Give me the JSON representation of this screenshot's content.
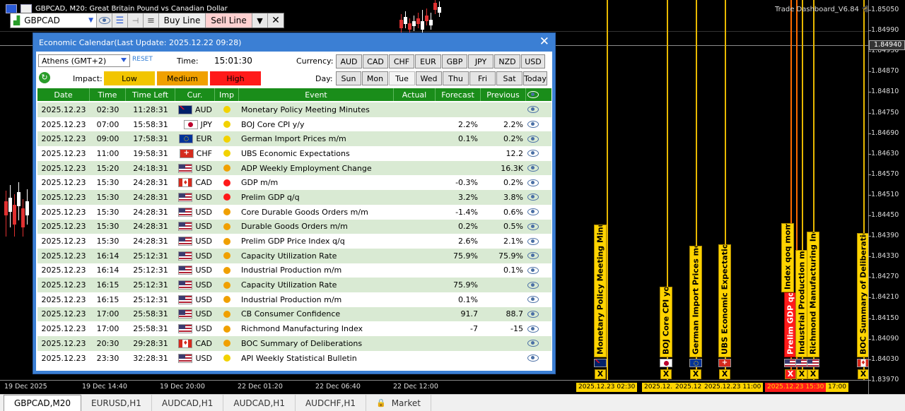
{
  "window": {
    "title": "GBPCAD, M20:  Great Britain Pound vs Canadian Dollar",
    "dashboard": "Trade Dashboard_V6.84"
  },
  "toolbar": {
    "symbol": "GBPCAD",
    "buy_label": "Buy Line",
    "sell_label": "Sell Line",
    "close_label": "✕",
    "dropdown_label": "▼"
  },
  "price_axis": {
    "ticks": [
      "1.85050",
      "1.84990",
      "1.84930",
      "1.84870",
      "1.84810",
      "1.84750",
      "1.84690",
      "1.84630",
      "1.84570",
      "1.84510",
      "1.84450",
      "1.84390",
      "1.84330",
      "1.84270",
      "1.84210",
      "1.84150",
      "1.84090",
      "1.84030",
      "1.83970"
    ],
    "current": "1.84940"
  },
  "time_axis": {
    "ticks": [
      "19 Dec 2025",
      "19 Dec 14:40",
      "19 Dec 20:00",
      "22 Dec 01:20",
      "22 Dec 06:40",
      "22 Dec 12:00"
    ],
    "badges": [
      {
        "text": "2025.12.23 02:30",
        "red": false
      },
      {
        "text": "2025.12.",
        "red": false
      },
      {
        "text": "2025.12.",
        "red": false
      },
      {
        "text": "2025.12.23 11:00",
        "red": false
      },
      {
        "text": "2025.12.23 15:30",
        "red": true
      },
      {
        "text": "17:00",
        "red": false
      }
    ]
  },
  "chart_events": [
    {
      "name": "Monetary Policy Meeting Minutes",
      "flag": "AUD",
      "red": false
    },
    {
      "name": "BOJ Core CPI yoy",
      "flag": "JPY",
      "red": false
    },
    {
      "name": "German Import Prices mom",
      "flag": "EUR",
      "red": false
    },
    {
      "name": "UBS Economic Expectations",
      "flag": "CHF",
      "red": false
    },
    {
      "name": "Prelim GDP qoq",
      "flag": "USD",
      "red": true
    },
    {
      "name": "Index qoq mom",
      "flag": "USD",
      "red": false
    },
    {
      "name": "Industrial Production mom",
      "flag": "USD",
      "red": false
    },
    {
      "name": "Richmond Manufacturing Index",
      "flag": "USD",
      "red": false
    },
    {
      "name": "BOC Summary of Deliberations",
      "flag": "CAD",
      "red": false
    }
  ],
  "x_marker": "X",
  "panel": {
    "title": "Economic Calendar(Last Update: 2025.12.22 09:28)",
    "close": "✕",
    "timezone": "Athens (GMT+2)",
    "reset": "RESET",
    "time_label": "Time:",
    "time_value": "15:01:30",
    "currency_label": "Currency:",
    "currencies": [
      "AUD",
      "CAD",
      "CHF",
      "EUR",
      "GBP",
      "JPY",
      "NZD",
      "USD"
    ],
    "impact_label": "Impact:",
    "impacts": [
      {
        "label": "Low",
        "color": "#f2c500"
      },
      {
        "label": "Medium",
        "color": "#f0a000"
      },
      {
        "label": "High",
        "color": "#ff1a1a"
      }
    ],
    "day_label": "Day:",
    "days": [
      "Sun",
      "Mon",
      "Tue",
      "Wed",
      "Thu",
      "Fri",
      "Sat",
      "Today"
    ],
    "selected_day": "Tue",
    "columns": [
      "Date",
      "Time",
      "Time Left",
      "Cur.",
      "Imp",
      "Event",
      "Actual",
      "Forecast",
      "Previous"
    ],
    "rows": [
      {
        "date": "2025.12.23",
        "time": "02:30",
        "left": "11:28:31",
        "cur": "AUD",
        "imp": "low",
        "event": "Monetary Policy Meeting Minutes",
        "actual": "",
        "forecast": "",
        "previous": ""
      },
      {
        "date": "2025.12.23",
        "time": "07:00",
        "left": "15:58:31",
        "cur": "JPY",
        "imp": "low",
        "event": "BOJ Core CPI y/y",
        "actual": "",
        "forecast": "2.2%",
        "previous": "2.2%"
      },
      {
        "date": "2025.12.23",
        "time": "09:00",
        "left": "17:58:31",
        "cur": "EUR",
        "imp": "low",
        "event": "German Import Prices m/m",
        "actual": "",
        "forecast": "0.1%",
        "previous": "0.2%"
      },
      {
        "date": "2025.12.23",
        "time": "11:00",
        "left": "19:58:31",
        "cur": "CHF",
        "imp": "low",
        "event": "UBS Economic Expectations",
        "actual": "",
        "forecast": "",
        "previous": "12.2"
      },
      {
        "date": "2025.12.23",
        "time": "15:20",
        "left": "24:18:31",
        "cur": "USD",
        "imp": "medium",
        "event": "ADP Weekly Employment Change",
        "actual": "",
        "forecast": "",
        "previous": "16.3K"
      },
      {
        "date": "2025.12.23",
        "time": "15:30",
        "left": "24:28:31",
        "cur": "CAD",
        "imp": "high",
        "event": "GDP m/m",
        "actual": "",
        "forecast": "-0.3%",
        "previous": "0.2%"
      },
      {
        "date": "2025.12.23",
        "time": "15:30",
        "left": "24:28:31",
        "cur": "USD",
        "imp": "high",
        "event": "Prelim GDP q/q",
        "actual": "",
        "forecast": "3.2%",
        "previous": "3.8%"
      },
      {
        "date": "2025.12.23",
        "time": "15:30",
        "left": "24:28:31",
        "cur": "USD",
        "imp": "medium",
        "event": "Core Durable Goods Orders m/m",
        "actual": "",
        "forecast": "-1.4%",
        "previous": "0.6%"
      },
      {
        "date": "2025.12.23",
        "time": "15:30",
        "left": "24:28:31",
        "cur": "USD",
        "imp": "medium",
        "event": "Durable Goods Orders m/m",
        "actual": "",
        "forecast": "0.2%",
        "previous": "0.5%"
      },
      {
        "date": "2025.12.23",
        "time": "15:30",
        "left": "24:28:31",
        "cur": "USD",
        "imp": "medium",
        "event": "Prelim GDP Price Index q/q",
        "actual": "",
        "forecast": "2.6%",
        "previous": "2.1%"
      },
      {
        "date": "2025.12.23",
        "time": "16:14",
        "left": "25:12:31",
        "cur": "USD",
        "imp": "medium",
        "event": "Capacity Utilization Rate",
        "actual": "",
        "forecast": "75.9%",
        "previous": "75.9%"
      },
      {
        "date": "2025.12.23",
        "time": "16:14",
        "left": "25:12:31",
        "cur": "USD",
        "imp": "medium",
        "event": "Industrial Production m/m",
        "actual": "",
        "forecast": "",
        "previous": "0.1%"
      },
      {
        "date": "2025.12.23",
        "time": "16:15",
        "left": "25:12:31",
        "cur": "USD",
        "imp": "medium",
        "event": "Capacity Utilization Rate",
        "actual": "",
        "forecast": "75.9%",
        "previous": ""
      },
      {
        "date": "2025.12.23",
        "time": "16:15",
        "left": "25:12:31",
        "cur": "USD",
        "imp": "medium",
        "event": "Industrial Production m/m",
        "actual": "",
        "forecast": "0.1%",
        "previous": ""
      },
      {
        "date": "2025.12.23",
        "time": "17:00",
        "left": "25:58:31",
        "cur": "USD",
        "imp": "medium",
        "event": "CB Consumer Confidence",
        "actual": "",
        "forecast": "91.7",
        "previous": "88.7"
      },
      {
        "date": "2025.12.23",
        "time": "17:00",
        "left": "25:58:31",
        "cur": "USD",
        "imp": "medium",
        "event": "Richmond Manufacturing Index",
        "actual": "",
        "forecast": "-7",
        "previous": "-15"
      },
      {
        "date": "2025.12.23",
        "time": "20:30",
        "left": "29:28:31",
        "cur": "CAD",
        "imp": "medium",
        "event": "BOC Summary of Deliberations",
        "actual": "",
        "forecast": "",
        "previous": ""
      },
      {
        "date": "2025.12.23",
        "time": "23:30",
        "left": "32:28:31",
        "cur": "USD",
        "imp": "low",
        "event": "API Weekly Statistical Bulletin",
        "actual": "",
        "forecast": "",
        "previous": ""
      }
    ]
  },
  "tabs": [
    "GBPCAD,M20",
    "EURUSD,H1",
    "AUDCAD,H1",
    "AUDCAD,H1",
    "AUDCHF,H1",
    "Market"
  ],
  "colors": {
    "impact_low": "#f2d200",
    "impact_medium": "#f0a000",
    "impact_high": "#ff1a1a",
    "header_green": "#1a8d1a",
    "panel_blue": "#3b7fd4"
  }
}
